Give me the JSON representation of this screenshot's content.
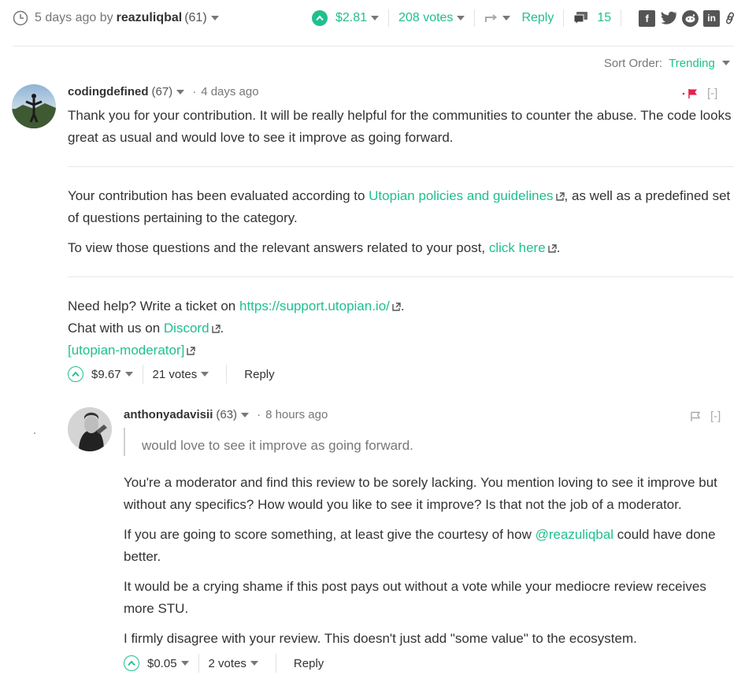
{
  "post": {
    "time_ago": "5 days ago by",
    "author": "reazuliqbal",
    "author_rep": "(61)",
    "payout": "$2.81",
    "votes": "208 votes",
    "reply_label": "Reply",
    "comment_count": "15"
  },
  "sort": {
    "label": "Sort Order:",
    "value": "Trending"
  },
  "comment1": {
    "author": "codingdefined",
    "rep": "(67)",
    "dot": "·",
    "time": "4 days ago",
    "collapse": "[-]",
    "para1": "Thank you for your contribution. It will be really helpful for the communities to counter the abuse. The code looks great as usual and would love to see it improve as going forward.",
    "para2_a": "Your contribution has been evaluated according to ",
    "para2_link": "Utopian policies and guidelines",
    "para2_b": ", as well as a predefined set of questions pertaining to the category.",
    "para3_a": "To view those questions and the relevant answers related to your post, ",
    "para3_link": "click here",
    "para3_b": ".",
    "help_a": "Need help? Write a ticket on ",
    "help_link": "https://support.utopian.io/",
    "help_b": ".",
    "chat_a": "Chat with us on ",
    "chat_link": "Discord",
    "chat_b": ".",
    "mod_link": "[utopian-moderator]",
    "payout": "$9.67",
    "votes": "21 votes",
    "reply_label": "Reply"
  },
  "comment2": {
    "author": "anthonyadavisii",
    "rep": "(63)",
    "dot": "·",
    "time": "8 hours ago",
    "collapse": "[-]",
    "quote": "would love to see it improve as going forward.",
    "para1": "You're a moderator and find this review to be sorely lacking. You mention loving to see it improve but without any specifics? How would you like to see it improve? Is that not the job of a moderator.",
    "para2_a": "If you are going to score something, at least give the courtesy of how ",
    "para2_link": "@reazuliqbal",
    "para2_b": " could have done better.",
    "para3": "It would be a crying shame if this post pays out without a vote while your mediocre review receives more STU.",
    "para4": "I firmly disagree with your review. This doesn't just add \"some value\" to the ecosystem.",
    "payout": "$0.05",
    "votes": "2 votes",
    "reply_label": "Reply"
  },
  "icons": [
    "clock-icon",
    "upvote-icon",
    "resteem-icon",
    "comments-icon",
    "facebook-icon",
    "twitter-icon",
    "reddit-icon",
    "linkedin-icon",
    "link-icon",
    "flag-icon",
    "external-link-icon"
  ],
  "colors": {
    "accent": "#1fbf8f",
    "flag": "#e8204a",
    "text": "#333333",
    "muted": "#777777"
  }
}
